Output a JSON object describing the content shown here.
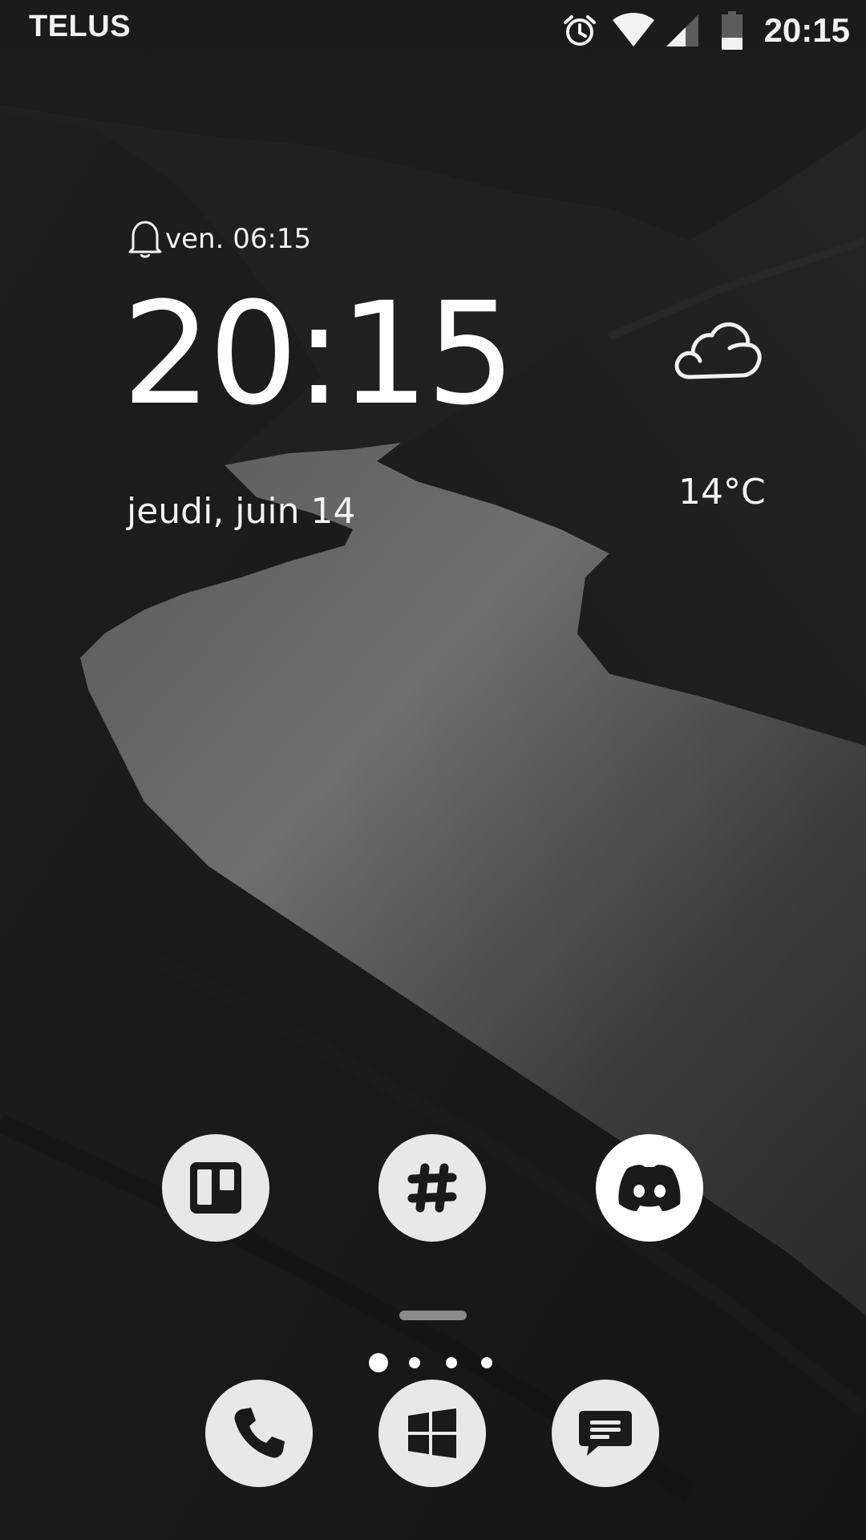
{
  "status_bar": {
    "carrier": "TELUS",
    "time": "20:15",
    "icons": [
      "alarm-icon",
      "wifi-icon",
      "cell-signal-icon",
      "battery-icon"
    ]
  },
  "clock_widget": {
    "next_alarm": "ven. 06:15",
    "time_hours": "20",
    "time_colon": ":",
    "time_minutes": "15",
    "date": "jeudi, juin 14"
  },
  "weather_widget": {
    "icon": "cloudy-icon",
    "temperature": "14°C"
  },
  "home_apps": [
    {
      "name": "trello",
      "icon": "trello-icon"
    },
    {
      "name": "slack",
      "icon": "slack-icon"
    },
    {
      "name": "discord",
      "icon": "discord-icon"
    }
  ],
  "pager": {
    "pages": 4,
    "active_page": 1
  },
  "dock": [
    {
      "name": "phone",
      "icon": "phone-icon"
    },
    {
      "name": "windows-launcher",
      "icon": "windows-icon"
    },
    {
      "name": "messages",
      "icon": "message-icon"
    }
  ],
  "colors": {
    "icon_background": "#e8e8e8",
    "icon_glyph": "#1a1a1a",
    "text": "#ffffff"
  }
}
